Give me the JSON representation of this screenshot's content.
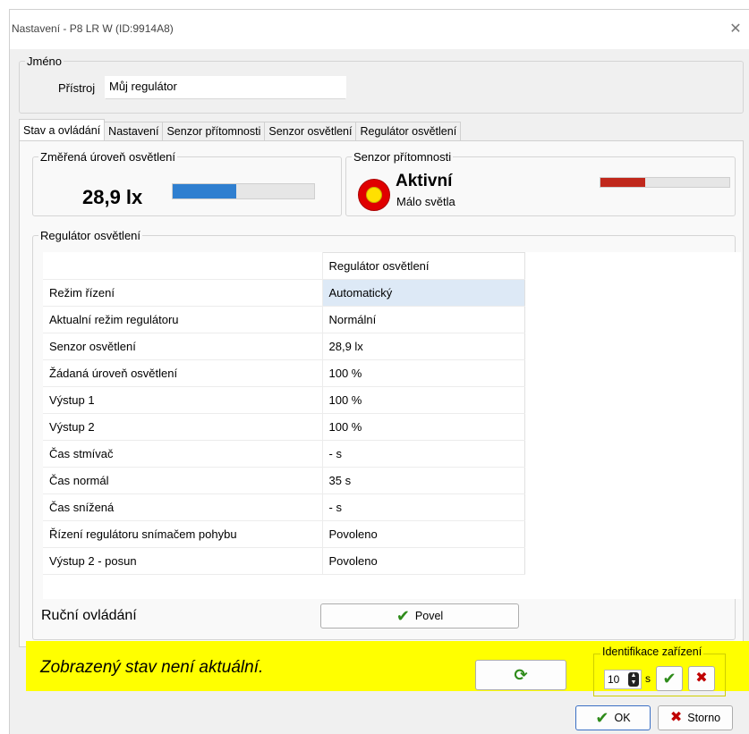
{
  "window": {
    "title": "Nastavení - P8 LR W (ID:9914A8)",
    "close_icon": "close-icon"
  },
  "name_group": {
    "legend": "Jméno",
    "device_label": "Přístroj",
    "device_value": "Můj regulátor"
  },
  "tabs": [
    {
      "label": "Stav a ovládání",
      "active": true
    },
    {
      "label": "Nastavení"
    },
    {
      "label": "Senzor přítomnosti"
    },
    {
      "label": "Senzor osvětlení"
    },
    {
      "label": "Regulátor osvětlení"
    }
  ],
  "measured": {
    "legend": "Změřená úroveň osvětlení",
    "value": "28,9 lx",
    "level": 0.45,
    "bar_color": "#2f7fd0"
  },
  "presence": {
    "legend": "Senzor přítomnosti",
    "status": "Aktivní",
    "substatus": "Málo světla",
    "level": 0.35,
    "bar_color": "#c0281c"
  },
  "regulator": {
    "legend": "Regulátor osvětlení",
    "column_header": "Regulátor osvětlení",
    "rows": [
      {
        "label": "Režim řízení",
        "value": "Automatický"
      },
      {
        "label": "Aktualní režim regulátoru",
        "value": "Normální"
      },
      {
        "label": "Senzor osvětlení",
        "value": "28,9 lx"
      },
      {
        "label": "Žádaná úroveň osvětlení",
        "value": "100 %"
      },
      {
        "label": "Výstup 1",
        "value": "100 %"
      },
      {
        "label": "Výstup 2",
        "value": "100 %"
      },
      {
        "label": "Čas stmívač",
        "value": "- s"
      },
      {
        "label": "Čas normál",
        "value": "35 s"
      },
      {
        "label": "Čas snížená",
        "value": "- s"
      },
      {
        "label": "Řízení regulátoru snímačem pohybu",
        "value": "Povoleno"
      },
      {
        "label": "Výstup 2 - posun",
        "value": "Povoleno"
      }
    ]
  },
  "manual": {
    "label": "Ruční ovládání",
    "button": "Povel"
  },
  "status_bar": {
    "message": "Zobrazený stav není aktuální.",
    "color": "#ffff00"
  },
  "identify": {
    "legend": "Identifikace zařízení",
    "seconds": "10",
    "unit": "s"
  },
  "footer": {
    "ok": "OK",
    "cancel": "Storno"
  }
}
